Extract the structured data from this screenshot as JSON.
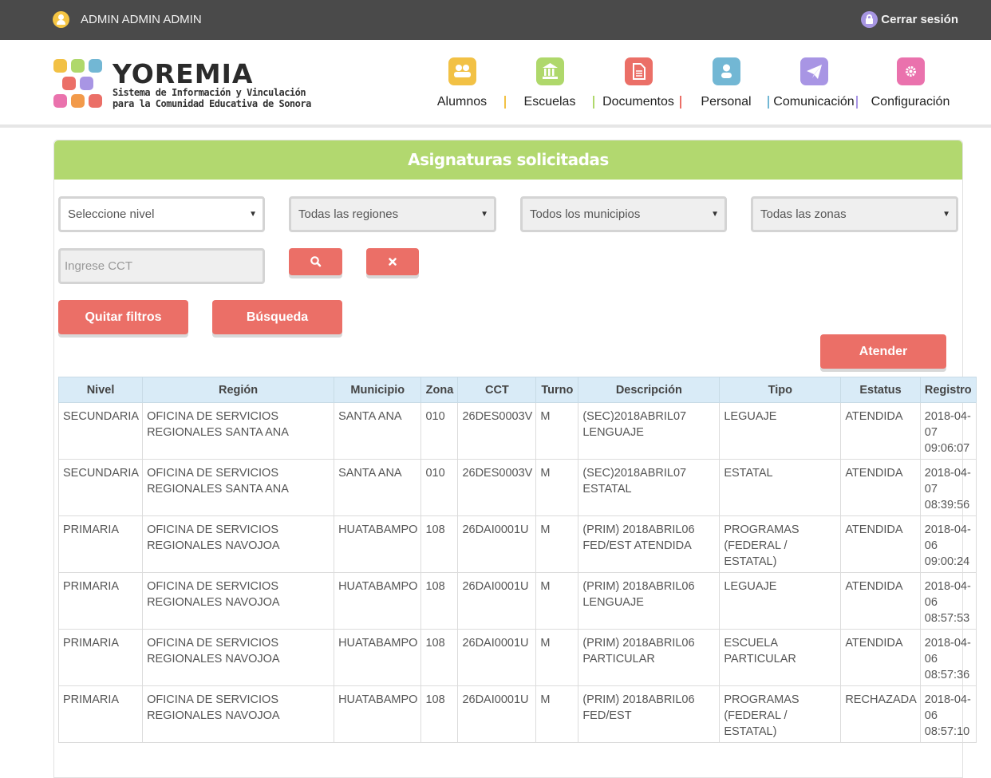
{
  "topbar": {
    "user_name": "ADMIN ADMIN ADMIN",
    "logout_label": "Cerrar sesión"
  },
  "logo": {
    "name": "YOREMIA",
    "tagline_line1": "Sistema de Información y Vinculación",
    "tagline_line2": "para la Comunidad Educativa de Sonora"
  },
  "nav": {
    "items": [
      {
        "label": "Alumnos",
        "icon": "users-icon",
        "color": "#f2c145"
      },
      {
        "label": "Escuelas",
        "icon": "institution-icon",
        "color": "#afd86b"
      },
      {
        "label": "Documentos",
        "icon": "file-icon",
        "color": "#eb6f67"
      },
      {
        "label": "Personal",
        "icon": "user-icon",
        "color": "#72b7d4"
      },
      {
        "label": "Comunicación",
        "icon": "paper-plane-icon",
        "color": "#a895e4"
      },
      {
        "label": "Configuración",
        "icon": "gear-icon",
        "color": "#ea72ad"
      }
    ]
  },
  "panel": {
    "title": "Asignaturas solicitadas"
  },
  "filters": {
    "nivel": "Seleccione nivel",
    "region": "Todas las regiones",
    "municipio": "Todos los municipios",
    "zona": "Todas las zonas",
    "cct_placeholder": "Ingrese CCT",
    "clear_filters_label": "Quitar filtros",
    "search_label": "Búsqueda",
    "attend_label": "Atender"
  },
  "table": {
    "headers": [
      "Nivel",
      "Región",
      "Municipio",
      "Zona",
      "CCT",
      "Turno",
      "Descripción",
      "Tipo",
      "Estatus",
      "Registro"
    ],
    "rows": [
      [
        "SECUNDARIA",
        "OFICINA DE SERVICIOS REGIONALES SANTA ANA",
        "SANTA ANA",
        "010",
        "26DES0003V",
        "M",
        "(SEC)2018ABRIL07 LENGUAJE",
        "LEGUAJE",
        "ATENDIDA",
        "2018-04-07 09:06:07"
      ],
      [
        "SECUNDARIA",
        "OFICINA DE SERVICIOS REGIONALES SANTA ANA",
        "SANTA ANA",
        "010",
        "26DES0003V",
        "M",
        "(SEC)2018ABRIL07 ESTATAL",
        "ESTATAL",
        "ATENDIDA",
        "2018-04-07 08:39:56"
      ],
      [
        "PRIMARIA",
        "OFICINA DE SERVICIOS REGIONALES NAVOJOA",
        "HUATABAMPO",
        "108",
        "26DAI0001U",
        "M",
        "(PRIM) 2018ABRIL06 FED/EST ATENDIDA",
        "PROGRAMAS (FEDERAL / ESTATAL)",
        "ATENDIDA",
        "2018-04-06 09:00:24"
      ],
      [
        "PRIMARIA",
        "OFICINA DE SERVICIOS REGIONALES NAVOJOA",
        "HUATABAMPO",
        "108",
        "26DAI0001U",
        "M",
        "(PRIM) 2018ABRIL06 LENGUAJE",
        "LEGUAJE",
        "ATENDIDA",
        "2018-04-06 08:57:53"
      ],
      [
        "PRIMARIA",
        "OFICINA DE SERVICIOS REGIONALES NAVOJOA",
        "HUATABAMPO",
        "108",
        "26DAI0001U",
        "M",
        "(PRIM) 2018ABRIL06 PARTICULAR",
        "ESCUELA PARTICULAR",
        "ATENDIDA",
        "2018-04-06 08:57:36"
      ],
      [
        "PRIMARIA",
        "OFICINA DE SERVICIOS REGIONALES NAVOJOA",
        "HUATABAMPO",
        "108",
        "26DAI0001U",
        "M",
        "(PRIM) 2018ABRIL06 FED/EST",
        "PROGRAMAS (FEDERAL / ESTATAL)",
        "RECHAZADA",
        "2018-04-06 08:57:10"
      ]
    ]
  }
}
